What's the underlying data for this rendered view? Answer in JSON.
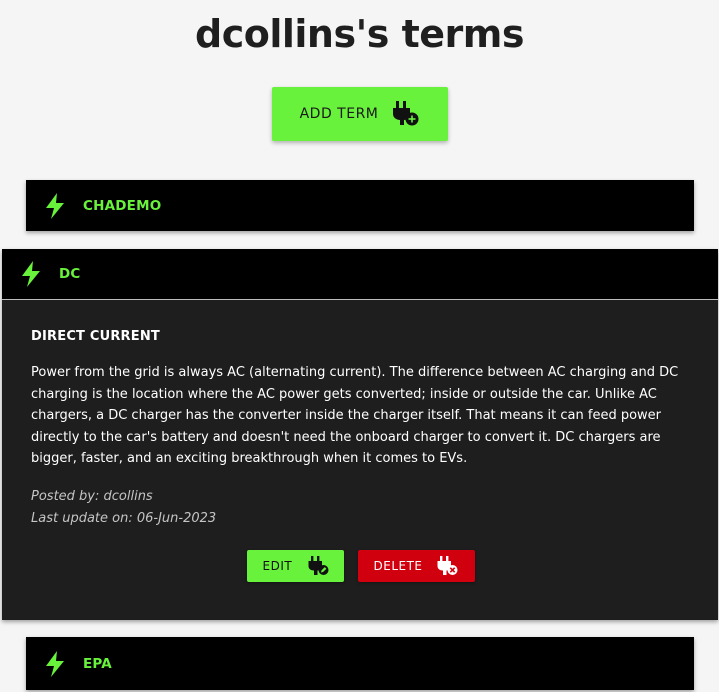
{
  "header": {
    "title": "dcollins's terms",
    "add_term_label": "ADD TERM"
  },
  "terms": [
    {
      "name": "CHADEMO",
      "expanded": false
    },
    {
      "name": "DC",
      "expanded": true,
      "definition_heading": "DIRECT CURRENT",
      "definition": "Power from the grid is always AC (alternating current). The difference between AC charging and DC charging is the location where the AC power gets converted; inside or outside the car. Unlike AC chargers, a DC charger has the converter inside the charger itself. That means it can feed power directly to the car's battery and doesn't need the onboard charger to convert it. DC chargers are bigger, faster, and an exciting breakthrough when it comes to EVs.",
      "posted_by": "Posted by: dcollins",
      "last_update": "Last update on: 06-Jun-2023",
      "edit_label": "EDIT",
      "delete_label": "DELETE"
    },
    {
      "name": "EPA",
      "expanded": false
    }
  ],
  "icons": {
    "term": "lightning-bolt-icon",
    "add": "plug-add-icon",
    "edit": "plug-edit-icon",
    "delete": "plug-delete-icon"
  },
  "colors": {
    "accent_green": "#69f23c",
    "danger_red": "#d1000e",
    "header_black": "#000000",
    "panel_dark": "#1e1e1e",
    "page_background": "#f5f5f5"
  }
}
